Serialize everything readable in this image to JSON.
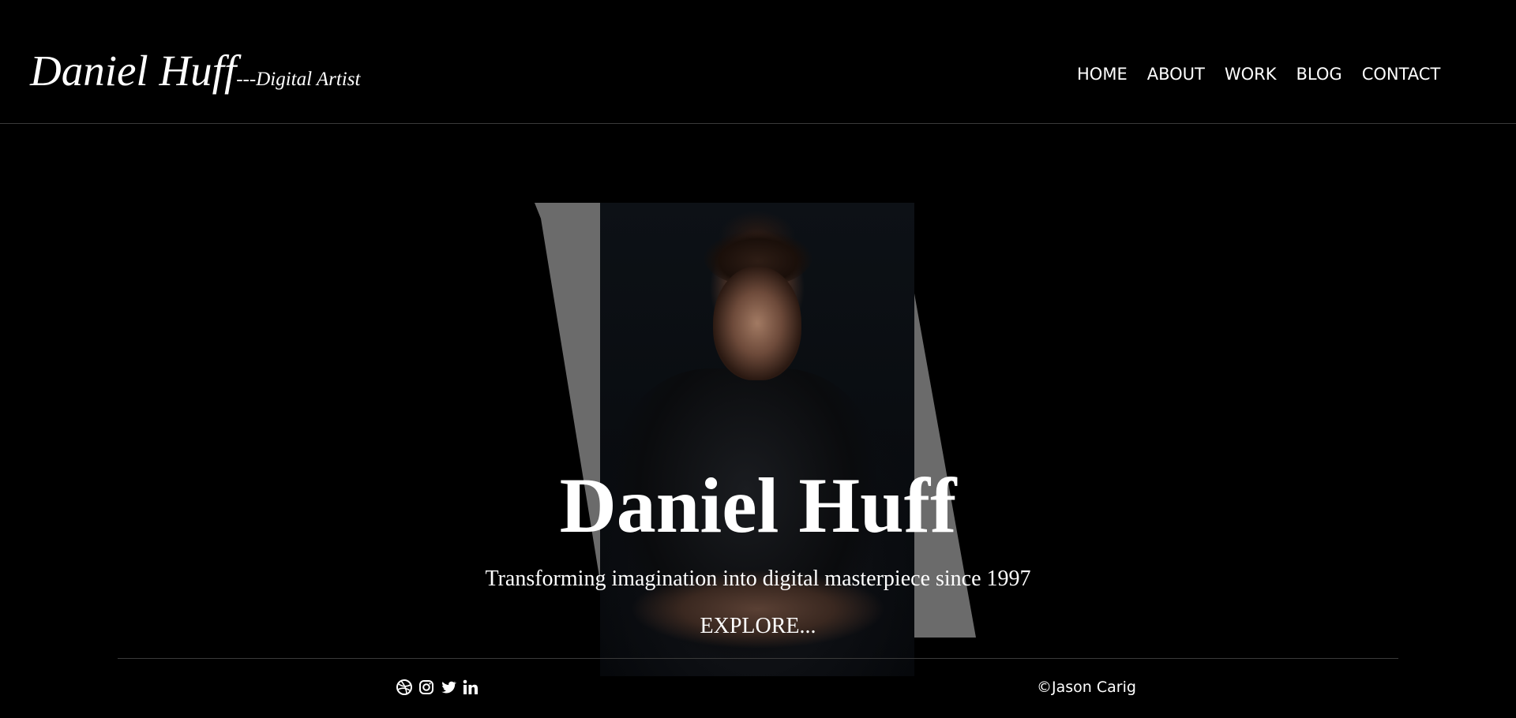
{
  "header": {
    "logo_name": "Daniel Huff",
    "logo_subtitle": "---Digital Artist",
    "nav": [
      {
        "label": "HOME"
      },
      {
        "label": "ABOUT"
      },
      {
        "label": "WORK"
      },
      {
        "label": "BLOG"
      },
      {
        "label": "CONTACT"
      }
    ]
  },
  "hero": {
    "title": "Daniel Huff",
    "subtitle": "Transforming imagination into digital masterpiece since 1997",
    "cta_label": "EXPLORE...",
    "stripe_color": "#6b6b6b"
  },
  "footer": {
    "social_icons": [
      "dribbble-icon",
      "instagram-icon",
      "twitter-icon",
      "linkedin-icon"
    ],
    "copyright": "©Jason Carig"
  }
}
